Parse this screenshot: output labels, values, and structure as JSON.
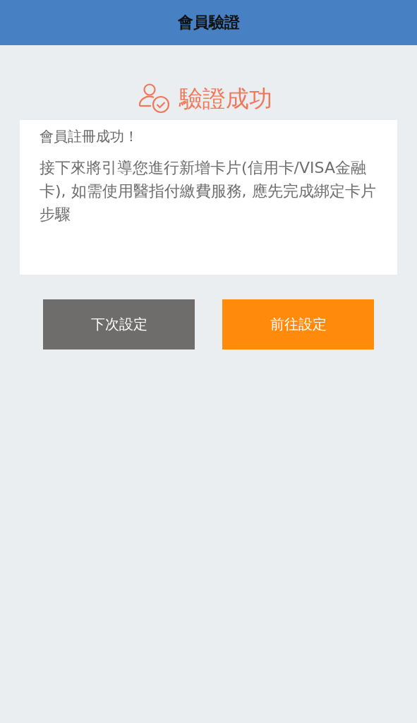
{
  "header": {
    "title": "會員驗證"
  },
  "status": {
    "title": "驗證成功"
  },
  "message": {
    "heading": "會員註冊成功！",
    "body": "接下來將引導您進行新增卡片(信用卡/VISA金融卡), 如需使用醫指付繳費服務, 應先完成綁定卡片步驟"
  },
  "buttons": [
    {
      "label": "下次設定",
      "kind": "secondary"
    },
    {
      "label": "前往設定",
      "kind": "primary"
    }
  ]
}
